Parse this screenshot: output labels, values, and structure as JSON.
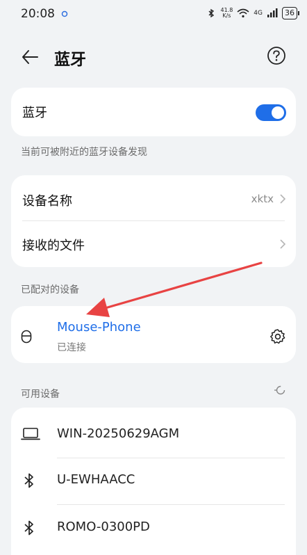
{
  "status": {
    "time": "20:08",
    "speed_top": "41.8",
    "speed_unit": "K/s",
    "net": "4G",
    "battery": "36"
  },
  "header": {
    "title": "蓝牙"
  },
  "bluetooth": {
    "label": "蓝牙",
    "enabled": true
  },
  "visibility_note": "当前可被附近的蓝牙设备发现",
  "settings": {
    "device_name_label": "设备名称",
    "device_name_value": "xktx",
    "received_files_label": "接收的文件"
  },
  "paired": {
    "section_label": "已配对的设备",
    "device": {
      "name": "Mouse-Phone",
      "status": "已连接",
      "icon": "mouse-icon"
    }
  },
  "available": {
    "section_label": "可用设备",
    "devices": [
      {
        "name": "WIN-20250629AGM",
        "icon": "laptop-icon"
      },
      {
        "name": "U-EWHAACC",
        "icon": "bluetooth-icon"
      },
      {
        "name": "ROMO-0300PD",
        "icon": "bluetooth-icon"
      }
    ]
  },
  "colors": {
    "accent": "#1f6ee8",
    "annotation_arrow": "#e84343"
  }
}
